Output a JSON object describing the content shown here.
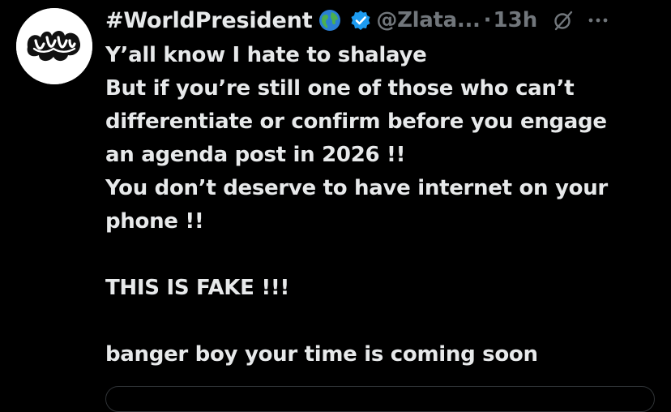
{
  "post": {
    "author": {
      "display_name": "#WorldPresident",
      "handle": "@Zlata...",
      "avatar_icon": "abstract-logo-avatar",
      "name_emoji": "globe-icon",
      "verified": true
    },
    "meta": {
      "separator": "·",
      "time": "13h"
    },
    "actions": {
      "grok_icon": "slash-circle-icon",
      "more_icon": "more-icon"
    },
    "text_lines": [
      "Y’all  know I hate to shalaye",
      "But if you’re still one of those who can’t",
      "differentiate or confirm before you engage",
      "an agenda post in 2026 !!",
      "You don’t deserve to have internet on your",
      "phone !!",
      "",
      "THIS IS FAKE !!!",
      "",
      "banger boy your time is coming soon"
    ]
  },
  "colors": {
    "background": "#000000",
    "primary_text": "#e7e9ea",
    "secondary_text": "#71767b",
    "verified_blue": "#1d9bf0",
    "border": "#2f3336"
  }
}
